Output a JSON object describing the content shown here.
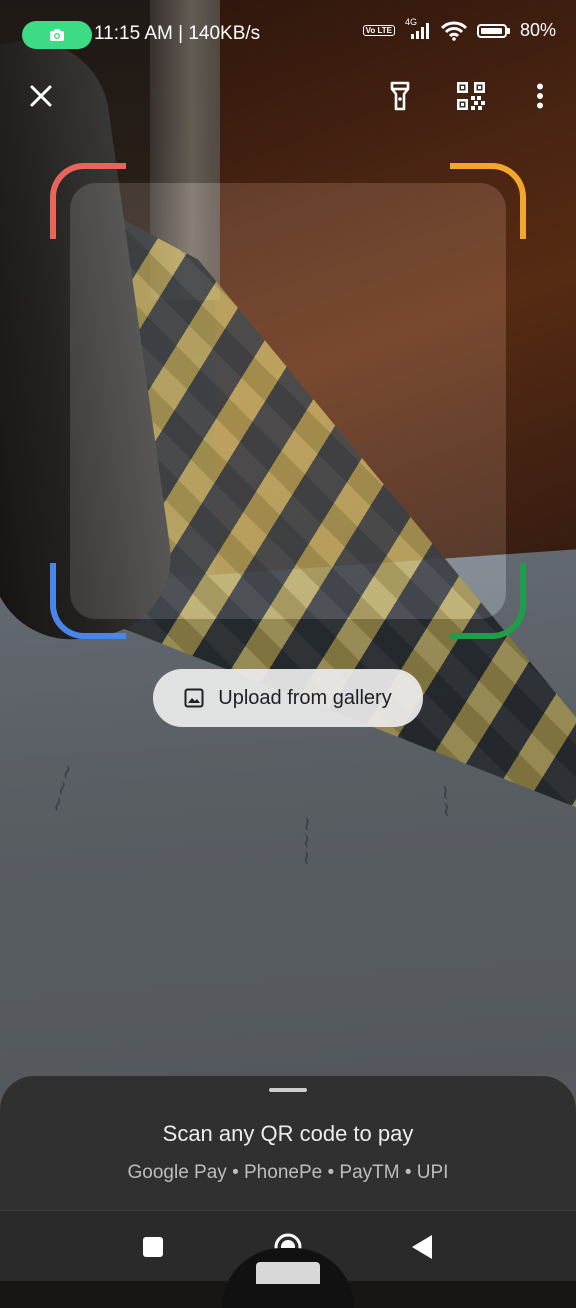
{
  "status_bar": {
    "time_speed": "11:15 AM | 140KB/s",
    "network": "4G",
    "volte": "Vo LTE",
    "battery": "80%",
    "battery_level": 0.8,
    "camera_indicator_color": "#3ddc84"
  },
  "toolbar": {
    "close_icon": "close-icon",
    "flashlight_icon": "flashlight-icon",
    "my_qr_icon": "qr-code-icon",
    "more_icon": "more-vert-icon"
  },
  "scanner": {
    "corner_colors": [
      "#e8655d",
      "#f2a72c",
      "#4a86e8",
      "#1e9e48"
    ]
  },
  "upload": {
    "label": "Upload from gallery",
    "icon": "image-icon"
  },
  "sheet": {
    "title": "Scan any QR code to pay",
    "subtitle": "Google Pay • PhonePe • PayTM • UPI"
  },
  "navbar": {
    "recents_icon": "square-icon",
    "home_icon": "home-circle-icon",
    "back_icon": "back-triangle-icon"
  }
}
